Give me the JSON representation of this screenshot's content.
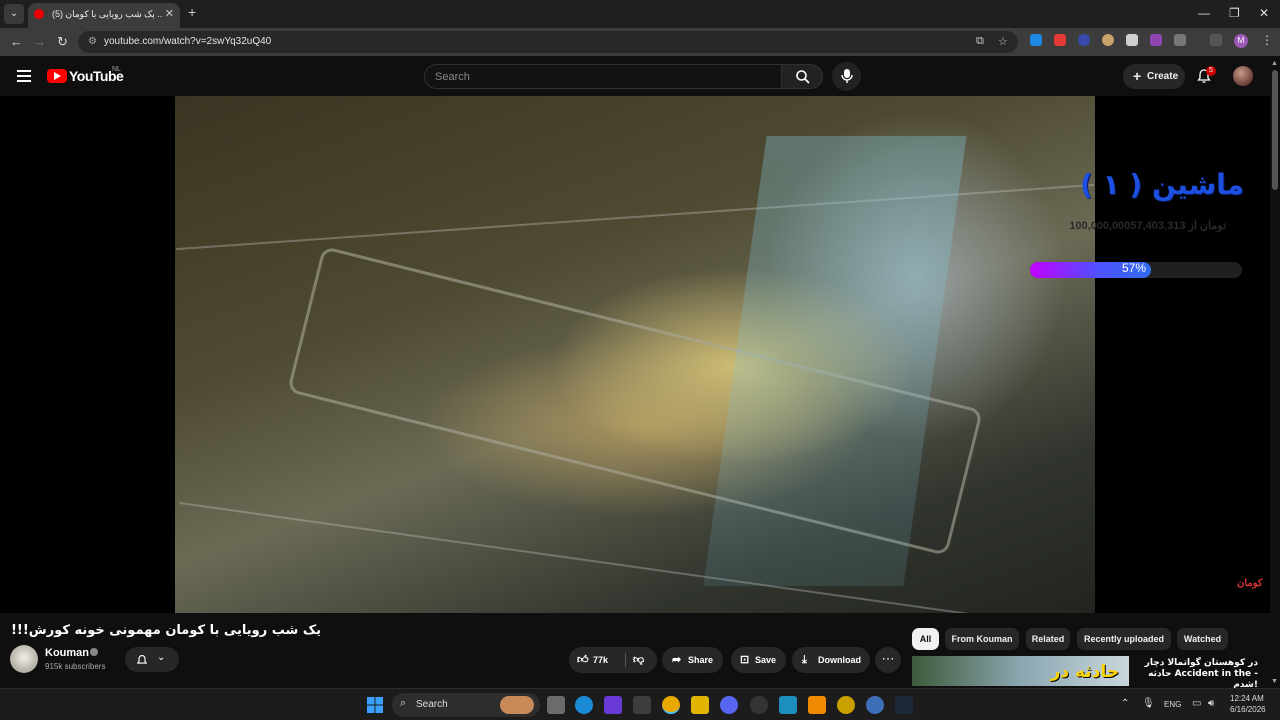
{
  "browser": {
    "tab_title": "(5) یک شب رویایی با کومان ...",
    "url": "youtube.com/watch?v=2swYq32uQ40"
  },
  "youtube": {
    "wordmark": "YouTube",
    "country": "NL",
    "search_placeholder": "Search",
    "create_label": "Create",
    "notification_count": "5"
  },
  "overlay": {
    "goal_title": "ماشین ( ۱ )",
    "goal_text": "100,000,000تومان  از  57,403,313",
    "progress_label": "57%",
    "progress_fraction": 0.57,
    "watermark": "کومان"
  },
  "video": {
    "title": "!!!یک شب رویایی با کومان مهمونی خونه کورش"
  },
  "channel": {
    "name": "Kouman",
    "subscribers": "915k subscribers"
  },
  "actions": {
    "like_count": "77k",
    "share": "Share",
    "save": "Save",
    "download": "Download"
  },
  "chips": [
    "All",
    "From Kouman",
    "Related",
    "Recently uploaded",
    "Watched"
  ],
  "recommended": {
    "thumb_text": "حادثه در",
    "title": "در کوهستان گواتمالا دچار حادثه Accident in the - شدم!"
  },
  "taskbar": {
    "search_label": "Search",
    "language": "ENG",
    "time": "12:24 AM",
    "date": "6/16/2026"
  },
  "colors": {
    "youtube_red": "#ff0000",
    "goal_title_blue": "#1d4fe0",
    "progress_start": "#c400ff",
    "progress_end": "#2f6df0"
  }
}
